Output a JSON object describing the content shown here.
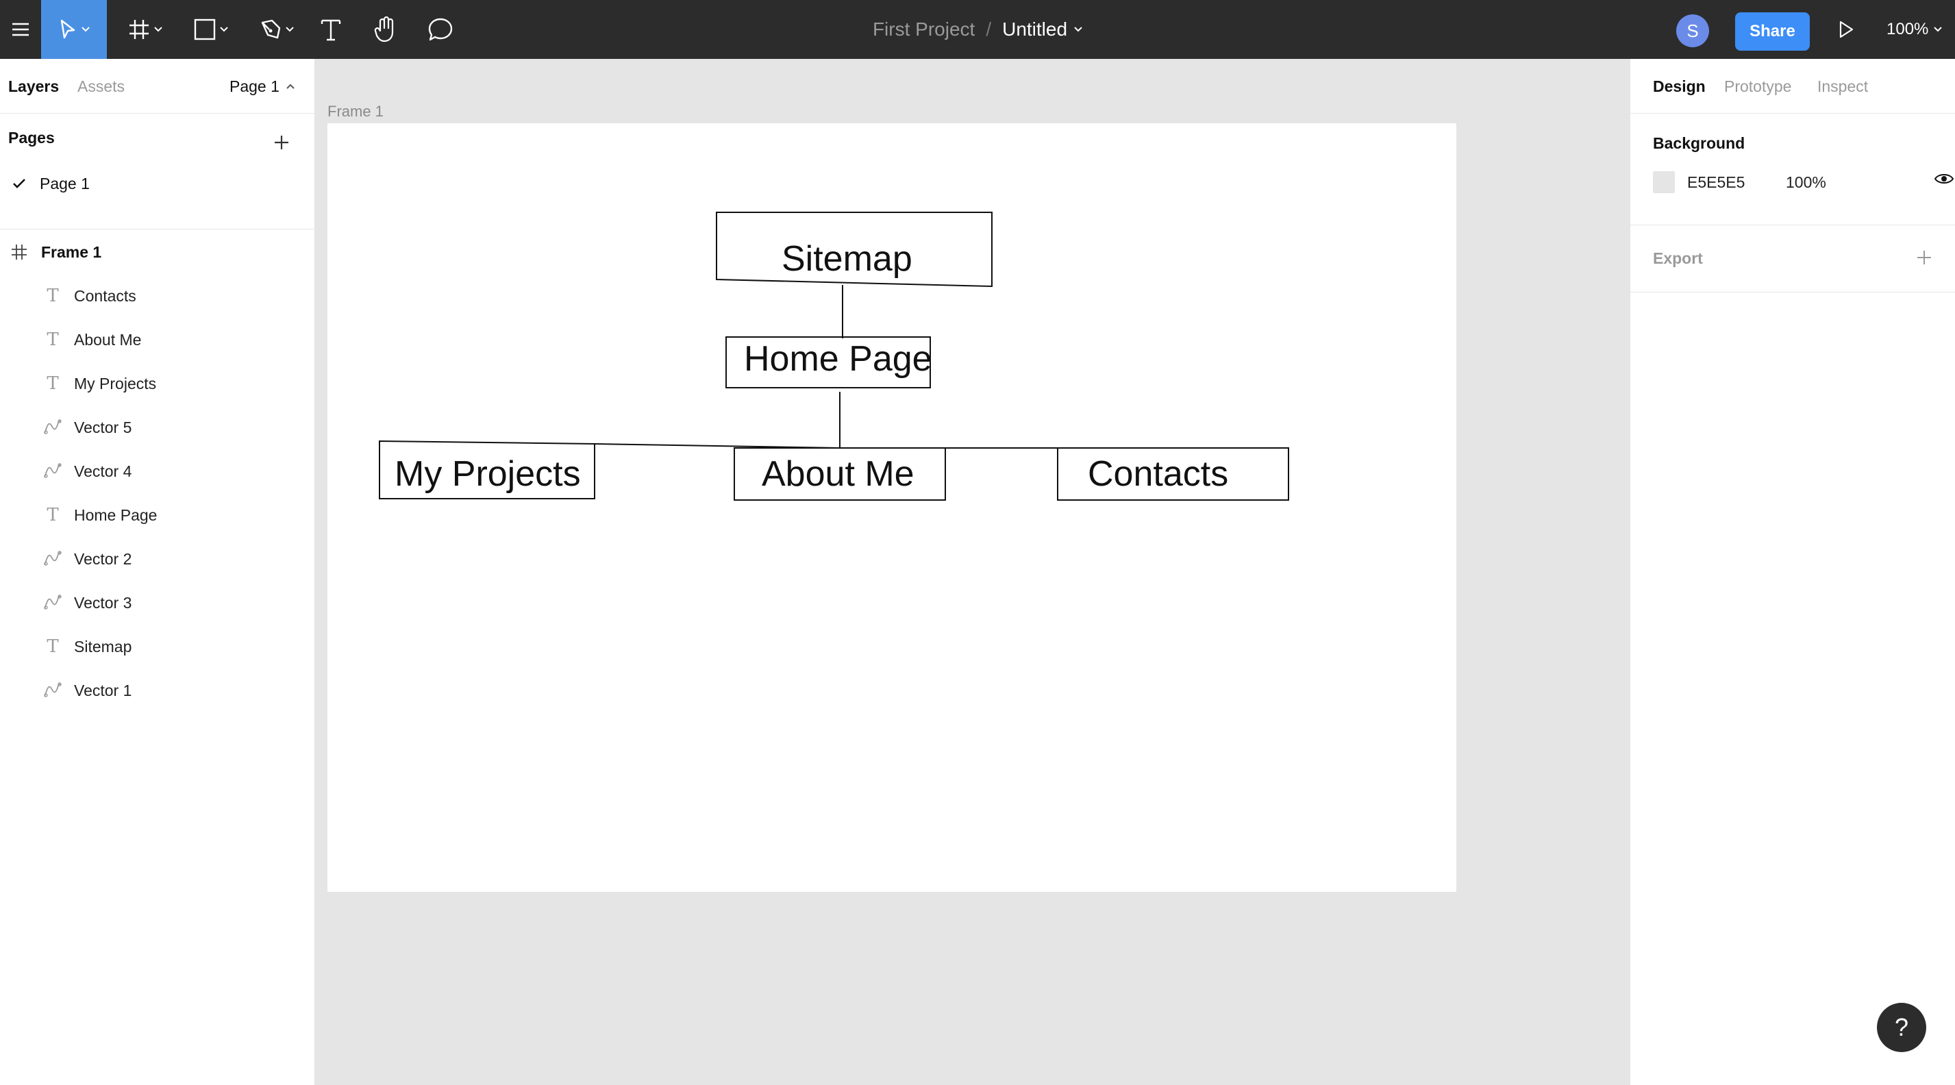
{
  "toolbar": {
    "project_name": "First Project",
    "separator": "/",
    "file_name": "Untitled",
    "avatar_initial": "S",
    "share_label": "Share",
    "zoom_level": "100%",
    "tools": [
      "main-menu",
      "move-tool",
      "frame-tool",
      "shape-tool",
      "pen-tool",
      "text-tool",
      "hand-tool",
      "comment-tool"
    ]
  },
  "left_panel": {
    "tabs": [
      "Layers",
      "Assets"
    ],
    "page_selector": "Page 1",
    "pages_header": "Pages",
    "pages": [
      "Page 1"
    ],
    "frame_layer": "Frame 1",
    "layers": [
      {
        "name": "Contacts",
        "type": "text"
      },
      {
        "name": "About Me",
        "type": "text"
      },
      {
        "name": "My Projects",
        "type": "text"
      },
      {
        "name": "Vector 5",
        "type": "vector"
      },
      {
        "name": "Vector 4",
        "type": "vector"
      },
      {
        "name": "Home Page",
        "type": "text"
      },
      {
        "name": "Vector 2",
        "type": "vector"
      },
      {
        "name": "Vector 3",
        "type": "vector"
      },
      {
        "name": "Sitemap",
        "type": "text"
      },
      {
        "name": "Vector 1",
        "type": "vector"
      }
    ]
  },
  "right_panel": {
    "tabs": [
      "Design",
      "Prototype",
      "Inspect"
    ],
    "background_label": "Background",
    "background_hex": "E5E5E5",
    "background_opacity": "100%",
    "export_label": "Export"
  },
  "canvas": {
    "frame_label": "Frame 1",
    "nodes": {
      "sitemap": "Sitemap",
      "home_page": "Home Page",
      "my_projects": "My Projects",
      "about_me": "About Me",
      "contacts": "Contacts"
    }
  },
  "help_label": "?",
  "colors": {
    "toolbar_bg": "#2c2c2c",
    "accent": "#4a90e2",
    "share_button": "#3d8ef6",
    "avatar": "#6b8be8",
    "canvas_bg": "#e5e5e5"
  }
}
